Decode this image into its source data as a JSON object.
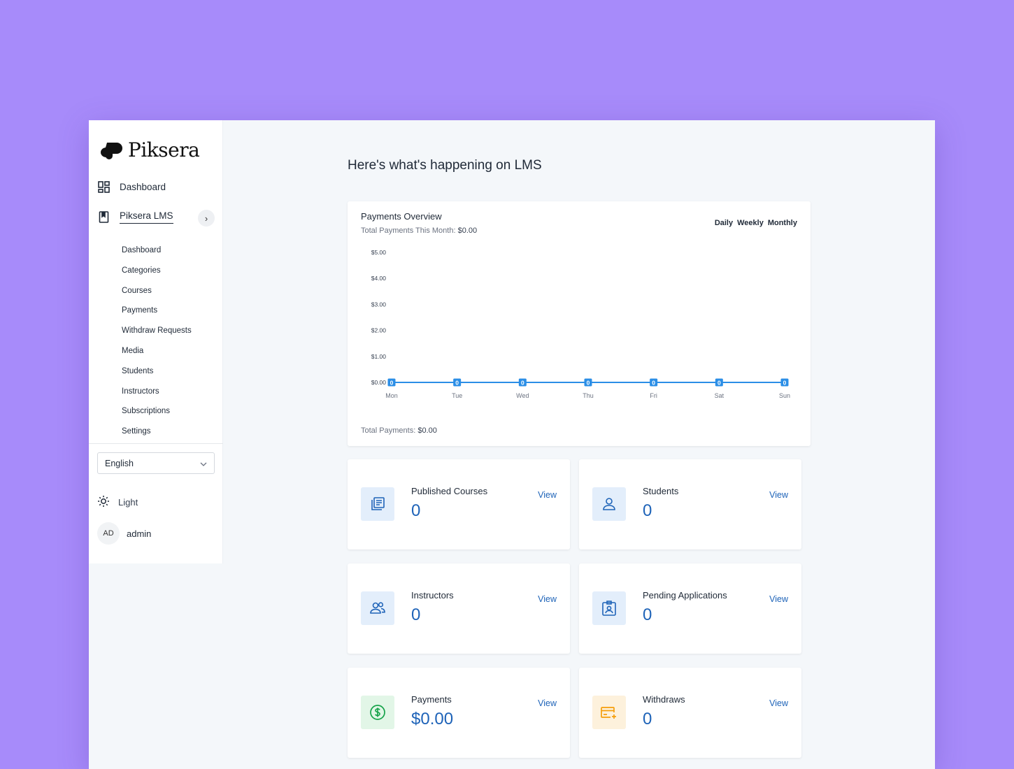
{
  "app": {
    "brand": "Piksera"
  },
  "sidebar": {
    "dashboard_label": "Dashboard",
    "lms_label": "Piksera LMS",
    "sub_items": [
      {
        "label": "Dashboard"
      },
      {
        "label": "Categories"
      },
      {
        "label": "Courses"
      },
      {
        "label": "Payments"
      },
      {
        "label": "Withdraw Requests"
      },
      {
        "label": "Media"
      },
      {
        "label": "Students"
      },
      {
        "label": "Instructors"
      },
      {
        "label": "Subscriptions"
      },
      {
        "label": "Settings"
      }
    ],
    "language": "English",
    "theme_label": "Light",
    "user": {
      "initials": "AD",
      "name": "admin"
    }
  },
  "main": {
    "title": "Here's what's happening on LMS",
    "chart_card": {
      "title": "Payments Overview",
      "subtitle_prefix": "Total Payments This Month:",
      "subtitle_value": "$0.00",
      "tabs": [
        "Daily",
        "Weekly",
        "Monthly"
      ],
      "footer_prefix": "Total Payments:",
      "footer_value": "$0.00"
    },
    "stats": [
      {
        "label": "Published Courses",
        "value": "0",
        "view": "View",
        "icon": "courses-icon"
      },
      {
        "label": "Students",
        "value": "0",
        "view": "View",
        "icon": "student-icon"
      },
      {
        "label": "Instructors",
        "value": "0",
        "view": "View",
        "icon": "instructors-icon"
      },
      {
        "label": "Pending Applications",
        "value": "0",
        "view": "View",
        "icon": "application-icon"
      },
      {
        "label": "Payments",
        "value": "$0.00",
        "view": "View",
        "icon": "dollar-icon"
      },
      {
        "label": "Withdraws",
        "value": "0",
        "view": "View",
        "icon": "card-icon"
      }
    ]
  },
  "colors": {
    "background": "#a78bfa",
    "accent": "#1e63b8",
    "line": "#2b8ee6",
    "icon_blue_bg": "#e3eefb",
    "icon_green_bg": "#e2f6e7",
    "icon_yellow_bg": "#fdf1dc"
  },
  "chart_data": {
    "type": "line",
    "categories": [
      "Mon",
      "Tue",
      "Wed",
      "Thu",
      "Fri",
      "Sat",
      "Sun"
    ],
    "series": [
      {
        "values": [
          0,
          0,
          0,
          0,
          0,
          0,
          0
        ]
      }
    ],
    "ytick_labels": [
      "$0.00",
      "$1.00",
      "$2.00",
      "$3.00",
      "$4.00",
      "$5.00"
    ],
    "ylim": [
      0,
      5
    ],
    "data_labels": [
      "0",
      "0",
      "0",
      "0",
      "0",
      "0",
      "0"
    ],
    "grid": false,
    "legend": "none"
  }
}
